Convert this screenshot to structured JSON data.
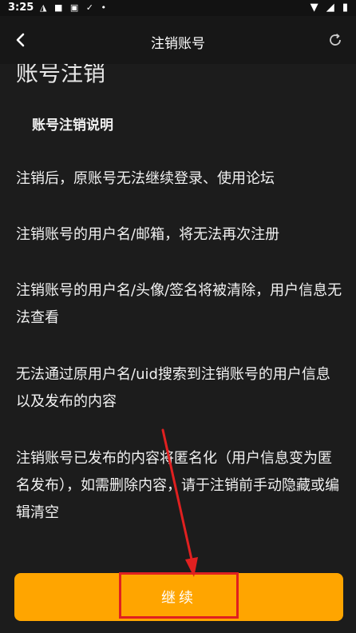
{
  "status_bar": {
    "time": "3:25",
    "left_icons": [
      "app-a-icon",
      "square-icon",
      "app-a-box-icon",
      "check-icon",
      "dot-icon"
    ],
    "right_icons": [
      "wifi-icon",
      "signal-icon",
      "battery-icon"
    ]
  },
  "header": {
    "title": "注销账号",
    "back_icon": "chevron-left-icon",
    "refresh_icon": "refresh-icon"
  },
  "main": {
    "page_title": "账号注销",
    "section_title": "账号注销说明",
    "paragraphs": [
      "注销后，原账号无法继续登录、使用论坛",
      "注销账号的用户名/邮箱，将无法再次注册",
      "注销账号的用户名/头像/签名将被清除，用户信息无法查看",
      "无法通过原用户名/uid搜索到注销账号的用户信息以及发布的内容",
      "注销账号已发布的内容将匿名化（用户信息变为匿名发布），如需删除内容，请于注销前手动隐藏或编辑清空"
    ]
  },
  "footer": {
    "continue_label": "继续"
  },
  "colors": {
    "background": "#1c1c1c",
    "accent": "#ffa500",
    "annotation": "#e02020"
  }
}
